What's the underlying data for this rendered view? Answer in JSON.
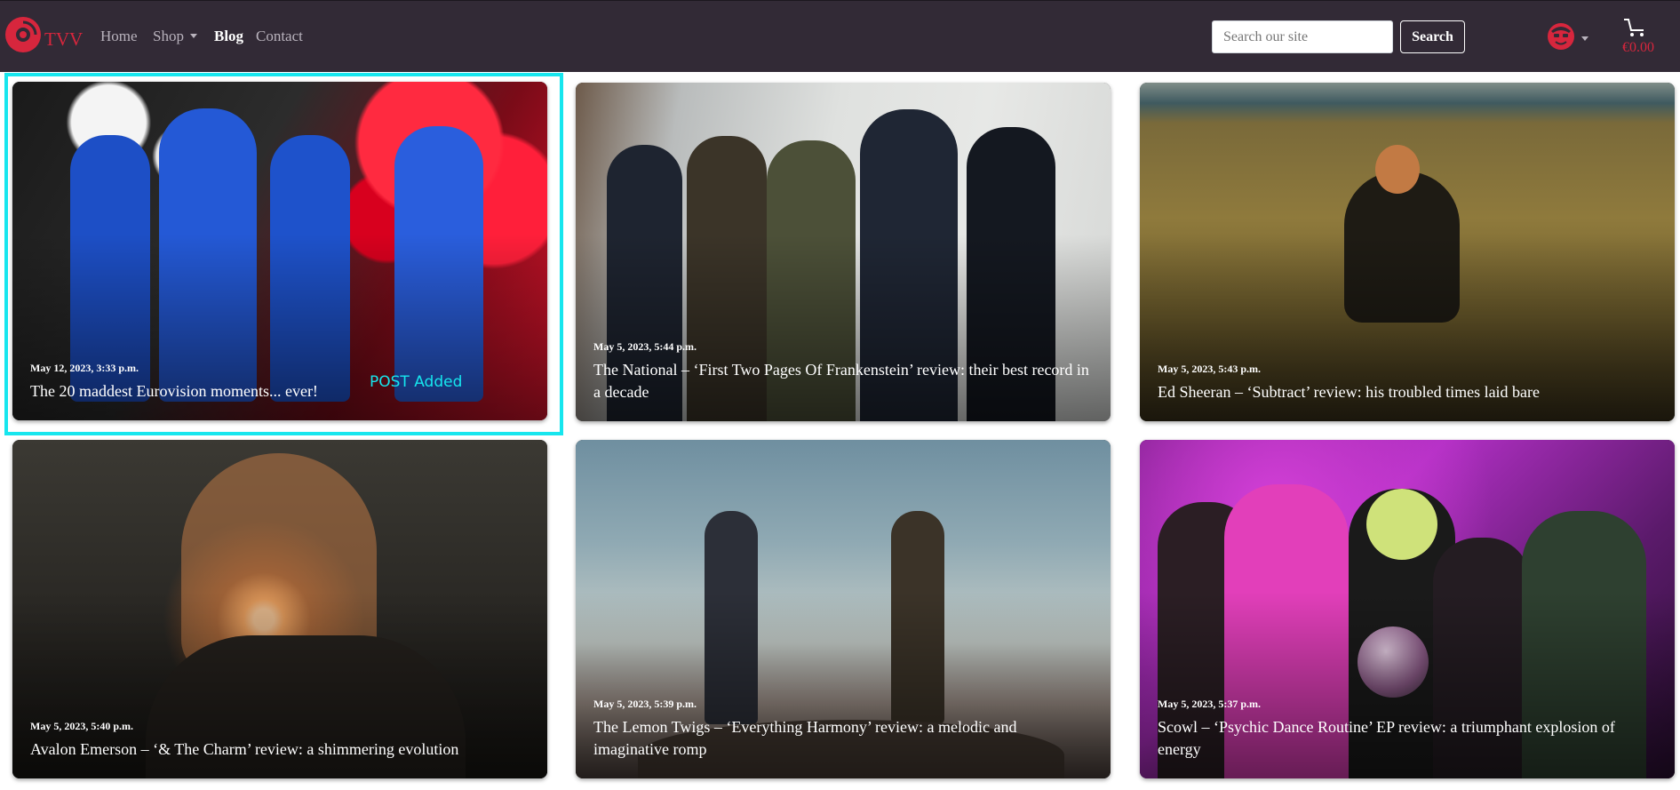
{
  "navbar": {
    "brand": "TVV",
    "links": [
      {
        "label": "Home"
      },
      {
        "label": "Shop"
      },
      {
        "label": "Blog"
      },
      {
        "label": "Contact"
      }
    ],
    "search_placeholder": "Search our site",
    "search_button": "Search",
    "account_icon": "user-avatar-icon",
    "cart_icon": "shopping-cart-icon",
    "cart_total": "€0.00"
  },
  "colors": {
    "navbar_bg": "#322a36",
    "brand": "#d7263d",
    "highlight": "#16e6ee"
  },
  "toast": "POST Added",
  "posts": [
    {
      "date": "May 12, 2023, 3:33 p.m.",
      "title": "The 20 maddest Eurovision moments... ever!"
    },
    {
      "date": "May 5, 2023, 5:44 p.m.",
      "title": "The National – ‘First Two Pages Of Frankenstein’ review: their best record in a decade"
    },
    {
      "date": "May 5, 2023, 5:43 p.m.",
      "title": "Ed Sheeran – ‘Subtract’ review: his troubled times laid bare"
    },
    {
      "date": "May 5, 2023, 5:40 p.m.",
      "title": "Avalon Emerson – ‘& The Charm’ review: a shimmering evolution"
    },
    {
      "date": "May 5, 2023, 5:39 p.m.",
      "title": "The Lemon Twigs – ‘Everything Harmony’ review: a melodic and imaginative romp"
    },
    {
      "date": "May 5, 2023, 5:37 p.m.",
      "title": "Scowl – ‘Psychic Dance Routine’ EP review: a triumphant explosion of energy"
    }
  ]
}
